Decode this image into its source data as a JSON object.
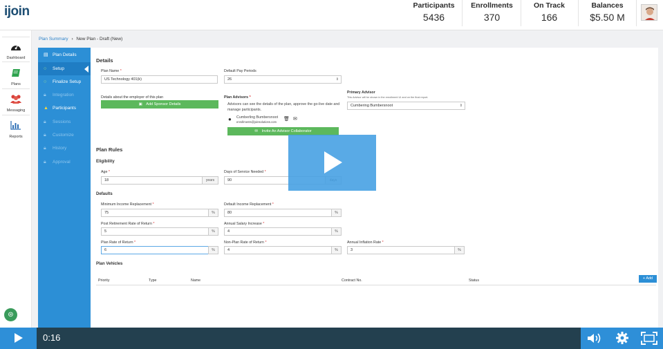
{
  "app": {
    "logo": "ijoin"
  },
  "header": {
    "stats": [
      {
        "label": "Participants",
        "value": "5436"
      },
      {
        "label": "Enrollments",
        "value": "370"
      },
      {
        "label": "On Track",
        "value": "166"
      },
      {
        "label": "Balances",
        "value": "$5.50 M"
      }
    ]
  },
  "rail": {
    "items": [
      {
        "label": "Dashboard",
        "icon": "dashboard-gauge-icon"
      },
      {
        "label": "Plans",
        "icon": "book-icon"
      },
      {
        "label": "Messaging",
        "icon": "people-icon"
      },
      {
        "label": "Reports",
        "icon": "bar-chart-icon"
      }
    ]
  },
  "breadcrumb": {
    "root": "Plan Summary",
    "sep": "›",
    "current": "New Plan - Draft (New)"
  },
  "subnav": {
    "items": [
      {
        "label": "Plan Details",
        "icon": "document-icon"
      },
      {
        "label": "Setup",
        "icon": "circle-icon"
      },
      {
        "label": "Finalize Setup",
        "icon": "circle-icon"
      },
      {
        "label": "Integration",
        "icon": "lock-icon"
      },
      {
        "label": "Participants",
        "icon": "warning-icon"
      },
      {
        "label": "Sessions",
        "icon": "lock-icon"
      },
      {
        "label": "Customize",
        "icon": "lock-icon"
      },
      {
        "label": "History",
        "icon": "lock-icon"
      },
      {
        "label": "Approval",
        "icon": "lock-icon"
      }
    ]
  },
  "details": {
    "title": "Details",
    "plan_name_label": "Plan Name",
    "plan_name_value": "US Technology 401(k)",
    "pay_periods_label": "Default Pay Periods",
    "pay_periods_value": "26",
    "employer_text": "Details about the employer of this plan",
    "add_sponsor_label": "Add Sponsor Details",
    "plan_advisors_label": "Plan Advisors",
    "advisors_desc": "Advisors can see the details of the plan, approve the go-live date and manage participants.",
    "advisor_name": "Cumberling Bumbersnoot",
    "advisor_email": "enrollments@joinsolutions.com",
    "invite_label": "Invite An Advisor Collaborator",
    "primary_advisor_label": "Primary Advisor",
    "primary_advisor_hint": "This Advisor will be shown in the enrollment UI and on the final report.",
    "primary_advisor_value": "Cumbering Bumbersnoot"
  },
  "rules": {
    "title": "Plan Rules",
    "eligibility_title": "Eligibility",
    "age_label": "Age",
    "age_value": "18",
    "age_unit": "years",
    "days_label": "Days of Service Needed",
    "days_value": "90",
    "days_unit": "days",
    "defaults_title": "Defaults",
    "min_income_label": "Minimum Income Replacement",
    "min_income_value": "75",
    "def_income_label": "Default Income Replacement",
    "def_income_value": "80",
    "post_ret_label": "Post Retirement Rate of Return",
    "post_ret_value": "5",
    "salary_inc_label": "Annual Salary Increase",
    "salary_inc_value": "4",
    "plan_ror_label": "Plan Rate of Return",
    "plan_ror_value": "6",
    "nonplan_ror_label": "Non-Plan Rate of Return",
    "nonplan_ror_value": "4",
    "inflation_label": "Annual Inflation Rate",
    "inflation_value": "3",
    "pct": "%"
  },
  "vehicles": {
    "title": "Plan Vehicles",
    "add_label": "Add",
    "columns": [
      "Priority",
      "Type",
      "Name",
      "Contract No.",
      "Status"
    ]
  },
  "player": {
    "time": "0:16"
  },
  "colors": {
    "brand_blue": "#2c8fd6",
    "green": "#5cb85c",
    "player_bar": "#23404f"
  }
}
